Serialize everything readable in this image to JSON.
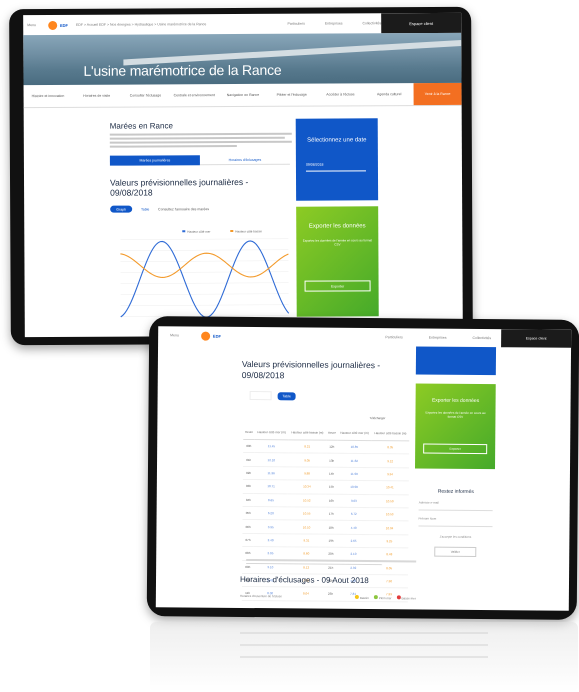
{
  "laptop": {
    "topbar": {
      "menu": "Menu",
      "logo": "EDF",
      "breadcrumb": "EDF > Accueil EDF > Nos énergies > Hydraulique > Usine marémotrice de la Rance",
      "links": [
        "Particuliers",
        "Entreprises",
        "Collectivités"
      ],
      "account": "Espace client"
    },
    "hero_title": "L'usine marémotrice de la Rance",
    "nav_items": [
      "Histoire et innovation",
      "Horaires de visite",
      "Consulter l'éclusage",
      "Centrale et environnement",
      "Navigation en Rance",
      "Piloter et l'éclusage",
      "Accéder à l'écluse",
      "Agenda culturel"
    ],
    "nav_cta": "Venir à la Rance",
    "main": {
      "heading": "Marées en Rance",
      "tabs": [
        "Marées journalières",
        "Horaires d'éclusages"
      ],
      "values_heading": "Valeurs prévisionnelles journalières - 09/08/2018",
      "pill_on": "Graph",
      "pill_off": "Table",
      "pill_note": "Consultez l'annuaire des marées"
    },
    "side": {
      "date_title": "Sélectionnez une date",
      "date_value": "09/08/2018",
      "export_title": "Exporter les données",
      "export_text": "Exportez les données de l'année en cours au format CSV",
      "export_button": "Exporter"
    },
    "chart_data": {
      "type": "line",
      "legend": [
        "Hauteur côté mer",
        "Hauteur côté bassin"
      ],
      "colors": [
        "#2f6bd6",
        "#f39a2b"
      ]
    }
  },
  "tablet": {
    "topbar": {
      "menu": "Menu",
      "logo": "EDF",
      "links": [
        "Particuliers",
        "Entreprises",
        "Collectivités"
      ],
      "account": "Espace client"
    },
    "values_heading": "Valeurs prévisionnelles journalières - 09/08/2018",
    "pill_on": "Table",
    "download": "Télécharger",
    "table": {
      "headers": [
        "Heure",
        "Hauteur côté mer (m)",
        "Hauteur côté bassin (m)",
        "Heure",
        "Hauteur côté mer (m)",
        "Hauteur côté bassin (m)"
      ],
      "rows": [
        [
          "00h",
          "11.45",
          "8.21",
          "12h",
          "10.85",
          "8.35"
        ],
        [
          "01h",
          "12.10",
          "9.05",
          "13h",
          "11.62",
          "9.12"
        ],
        [
          "02h",
          "11.96",
          "9.88",
          "14h",
          "11.90",
          "9.94"
        ],
        [
          "03h",
          "10.71",
          "10.34",
          "15h",
          "10.98",
          "10.41"
        ],
        [
          "04h",
          "8.65",
          "10.52",
          "16h",
          "9.03",
          "10.50"
        ],
        [
          "05h",
          "6.20",
          "10.55",
          "17h",
          "6.72",
          "10.53"
        ],
        [
          "06h",
          "3.95",
          "10.10",
          "18h",
          "4.40",
          "10.04"
        ],
        [
          "07h",
          "2.40",
          "9.31",
          "19h",
          "2.65",
          "9.25"
        ],
        [
          "08h",
          "2.05",
          "8.60",
          "20h",
          "2.10",
          "8.48"
        ],
        [
          "09h",
          "3.10",
          "8.12",
          "21h",
          "2.92",
          "8.05"
        ],
        [
          "10h",
          "5.42",
          "7.98",
          "22h",
          "4.95",
          "7.90"
        ],
        [
          "11h",
          "8.30",
          "8.04",
          "23h",
          "7.81",
          "7.99"
        ]
      ]
    },
    "heading2": "Horaires d'éclusages - 09 Aout 2018",
    "legend_note": "Horaires d'ouverture de l'écluse",
    "legend_keys": [
      "Bassin",
      "Plein mer",
      "Basse mer"
    ],
    "side": {
      "export_title": "Exporter les données",
      "export_text": "Exportez les données de l'année en cours au format CSV",
      "export_button": "Exporter",
      "info_title": "Restez informés",
      "field_1": "Adresse e-mail",
      "field_2": "Prénom Nom",
      "check": "J'accepte les conditions",
      "submit": "Valider"
    }
  }
}
